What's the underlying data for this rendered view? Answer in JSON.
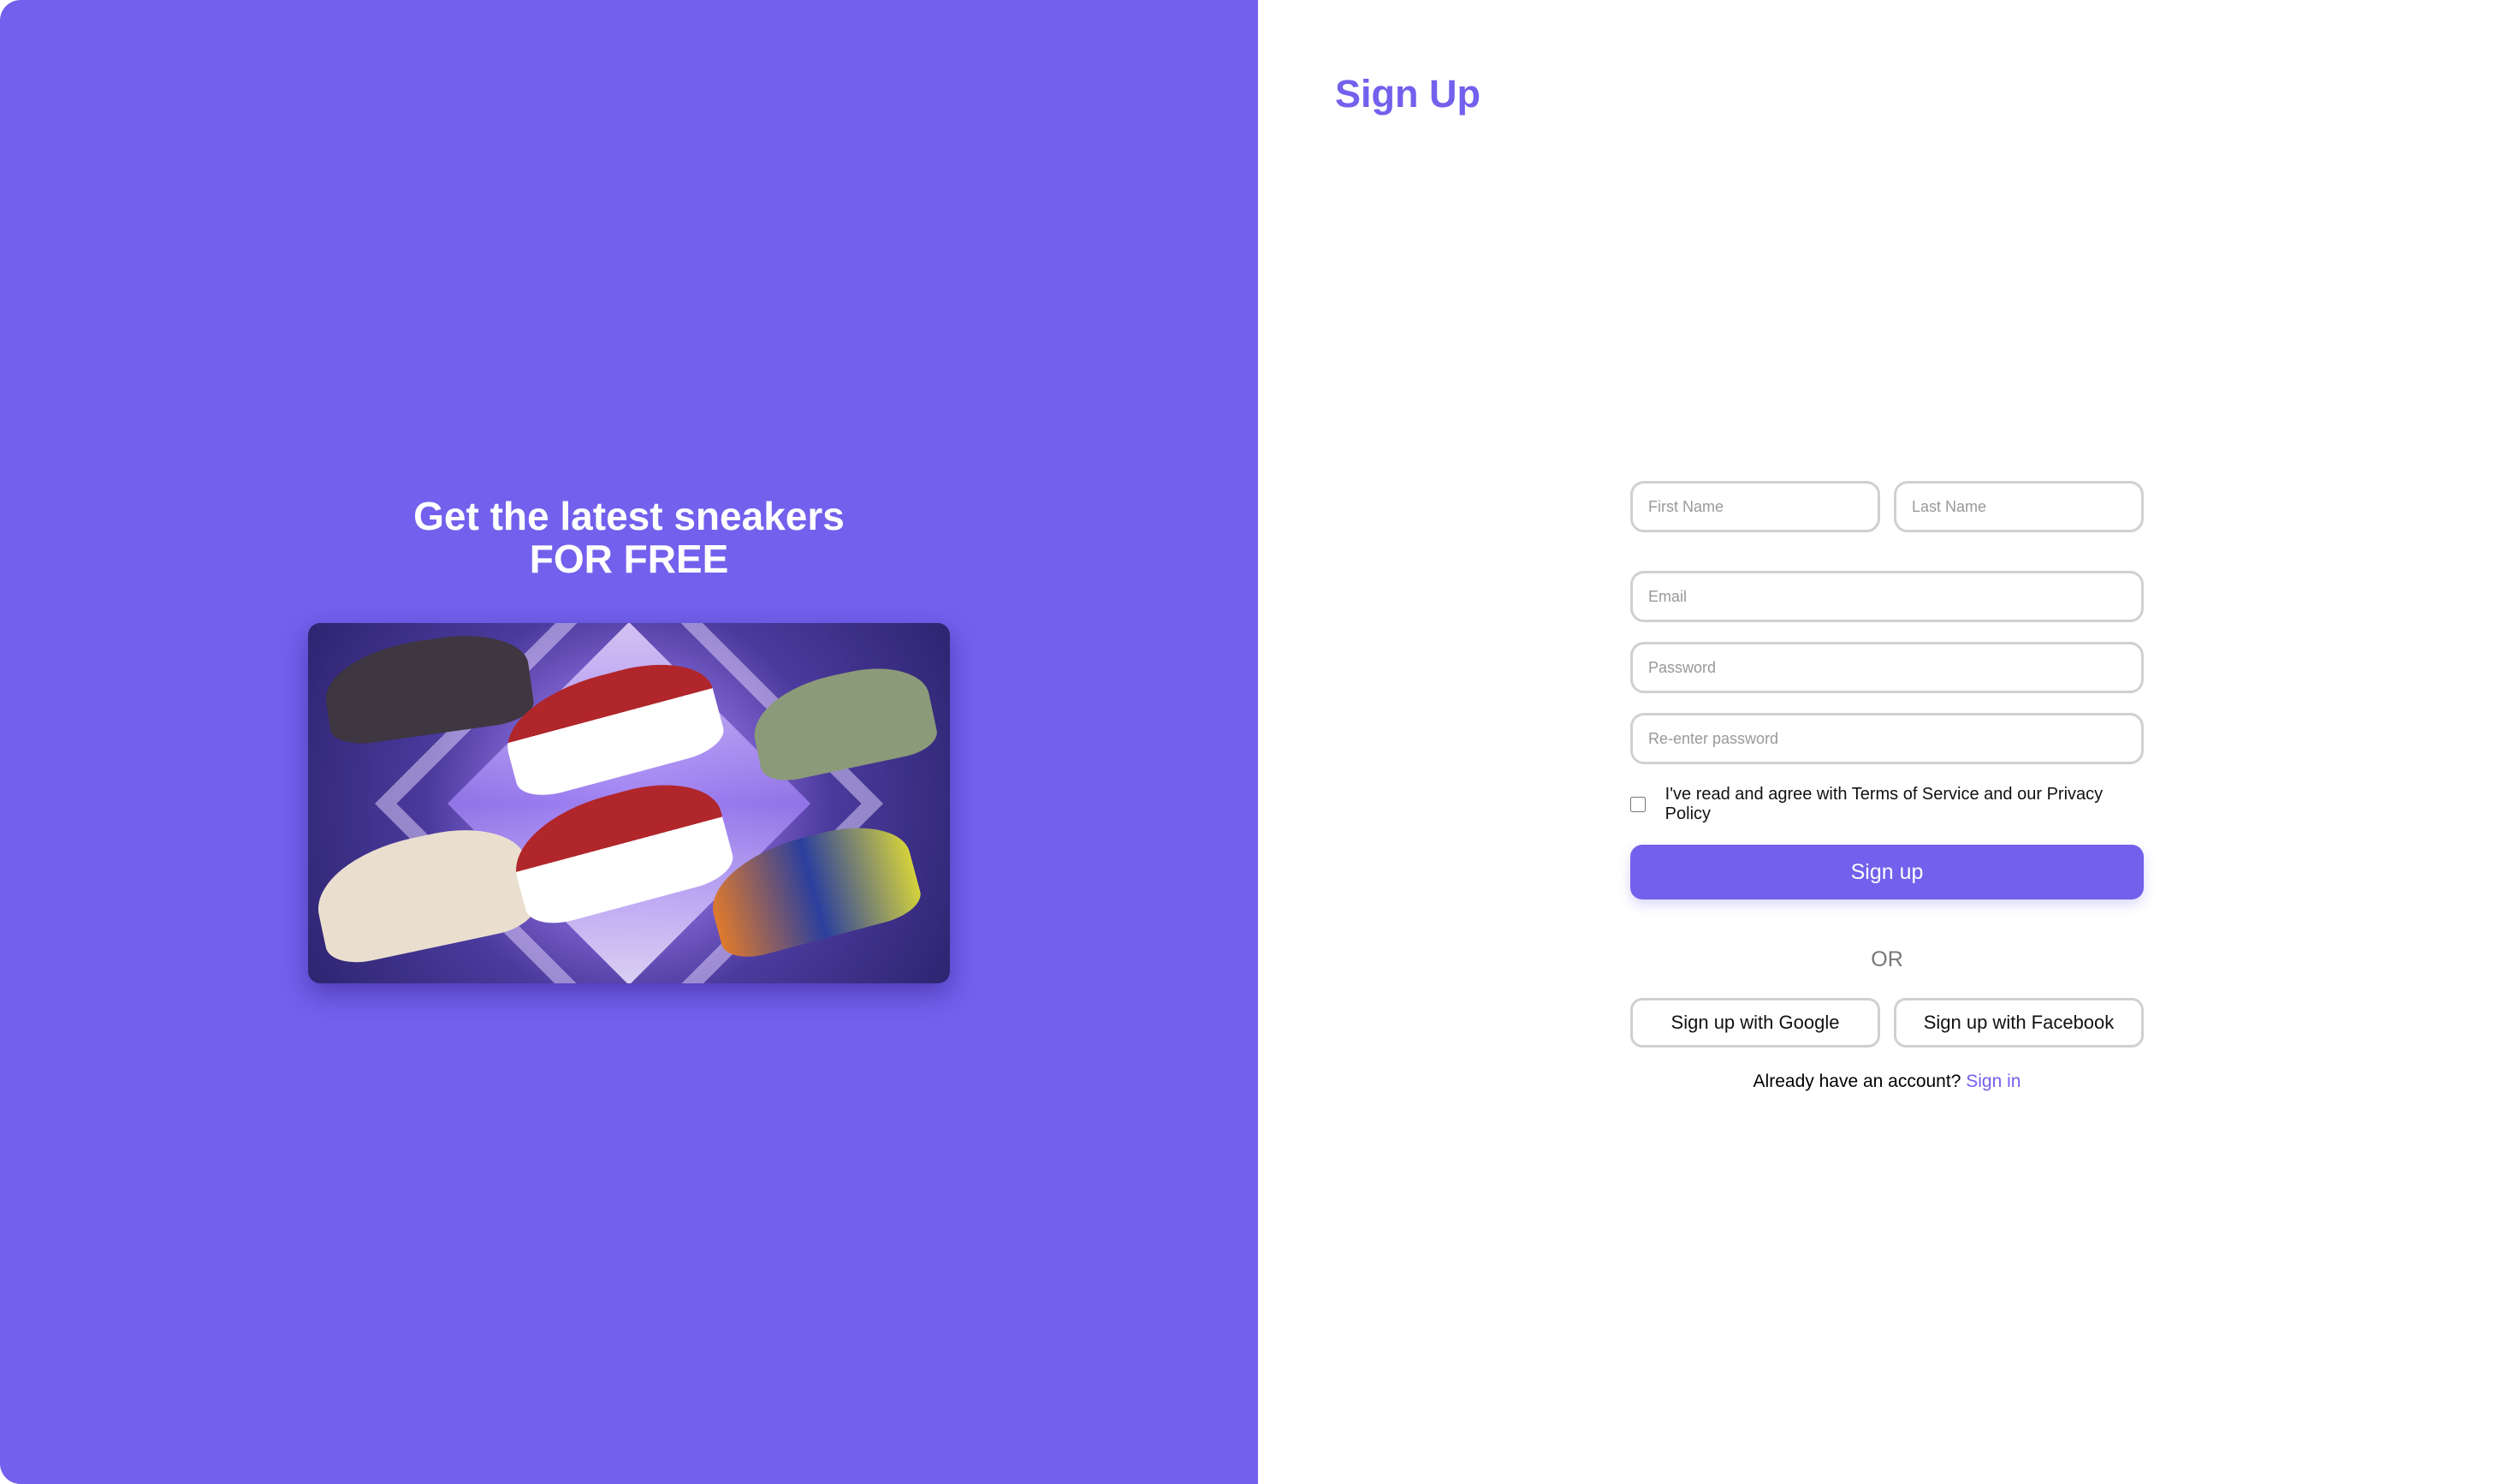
{
  "hero": {
    "line1": "Get the latest sneakers",
    "line2": "FOR FREE"
  },
  "title": "Sign Up",
  "form": {
    "first_name_placeholder": "First Name",
    "last_name_placeholder": "Last Name",
    "email_placeholder": "Email",
    "password_placeholder": "Password",
    "reenter_placeholder": "Re-enter password",
    "terms_label": "I've read and agree with Terms of Service and our Privacy Policy",
    "submit_label": "Sign up"
  },
  "or_label": "OR",
  "social": {
    "google": "Sign up with Google",
    "facebook": "Sign up with Facebook"
  },
  "signin": {
    "prompt": "Already have an account?",
    "link": "Sign in"
  },
  "colors": {
    "accent": "#7360ec"
  }
}
